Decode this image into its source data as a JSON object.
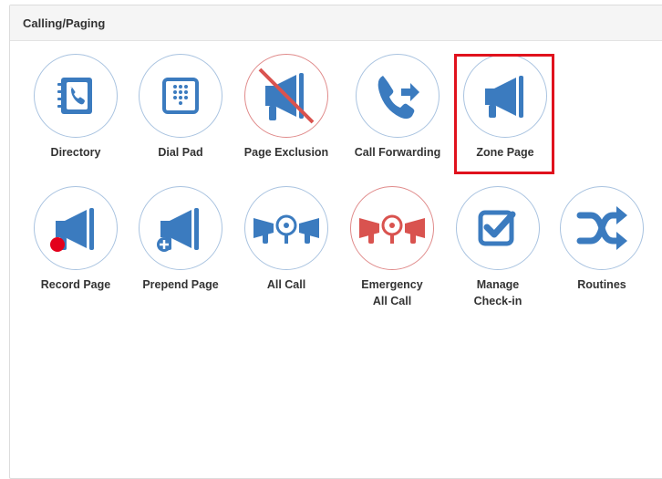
{
  "panel": {
    "title": "Calling/Paging"
  },
  "tiles": [
    {
      "label": "Directory",
      "icon": "directory-icon"
    },
    {
      "label": "Dial Pad",
      "icon": "dialpad-icon"
    },
    {
      "label": "Page Exclusion",
      "icon": "page-exclusion-icon"
    },
    {
      "label": "Call Forwarding",
      "icon": "call-forwarding-icon"
    },
    {
      "label": "Zone Page",
      "icon": "megaphone-icon",
      "selected": true
    },
    {
      "label": "Record Page",
      "icon": "record-page-icon"
    },
    {
      "label": "Prepend Page",
      "icon": "prepend-page-icon"
    },
    {
      "label": "All Call",
      "icon": "all-call-icon"
    },
    {
      "label_line1": "Emergency",
      "label_line2": "All Call",
      "icon": "emergency-all-call-icon"
    },
    {
      "label_line1": "Manage",
      "label_line2": "Check-in",
      "icon": "checkbox-icon"
    },
    {
      "label": "Routines",
      "icon": "shuffle-icon"
    }
  ],
  "colors": {
    "accent": "#3b7bbf",
    "danger": "#d9534f",
    "selection": "#e0121d"
  }
}
